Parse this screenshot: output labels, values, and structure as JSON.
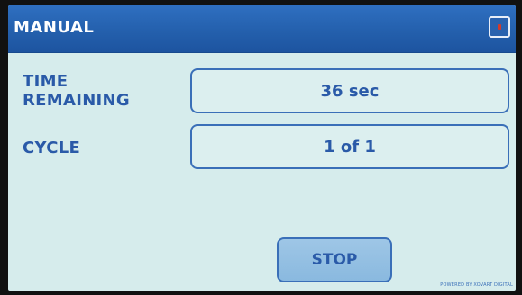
{
  "header": {
    "title": "MANUAL",
    "close_icon": "close-icon"
  },
  "rows": {
    "time_label_line1": "TIME",
    "time_label_line2": "REMAINING",
    "time_value": "36 sec",
    "cycle_label": "CYCLE",
    "cycle_value": "1 of 1"
  },
  "actions": {
    "stop_label": "STOP"
  },
  "footer": {
    "text": "POWERED BY XOVART DIGITAL"
  },
  "colors": {
    "header_blue": "#2460ad",
    "background": "#d6ecec",
    "text_blue": "#2a5aa8",
    "close_dot_red": "#d43a2a"
  }
}
